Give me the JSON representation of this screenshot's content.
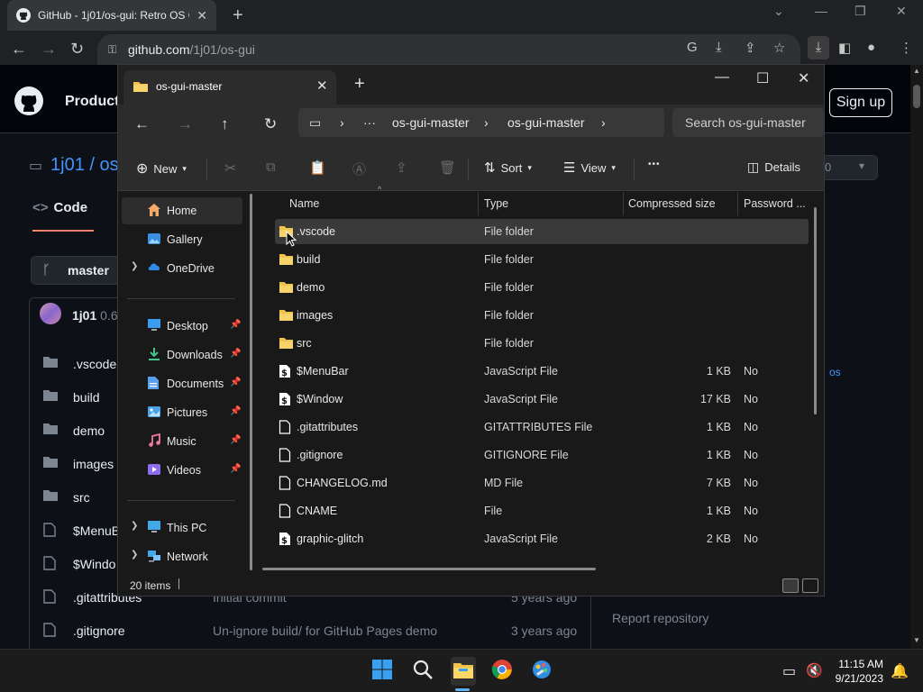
{
  "browser": {
    "tab_title": "GitHub - 1j01/os-gui: Retro OS G",
    "url_host": "github.com",
    "url_path": "/1j01/os-gui"
  },
  "github": {
    "product_label": "Product",
    "signup_label": "Sign up",
    "repo_owner": "1j01",
    "repo_name_partial": "os",
    "code_tab": "Code",
    "branch": "master",
    "commit_author": "1j01",
    "commit_version": "0.6.",
    "report": "Report repository",
    "files": [
      {
        "name": ".vscode",
        "type": "folder",
        "msg": "",
        "age": ""
      },
      {
        "name": "build",
        "type": "folder",
        "msg": "",
        "age": ""
      },
      {
        "name": "demo",
        "type": "folder",
        "msg": "",
        "age": ""
      },
      {
        "name": "images",
        "type": "folder",
        "msg": "",
        "age": ""
      },
      {
        "name": "src",
        "type": "folder",
        "msg": "",
        "age": ""
      },
      {
        "name": "$MenuB",
        "type": "file",
        "msg": "",
        "age": ""
      },
      {
        "name": "$Windo",
        "type": "file",
        "msg": "",
        "age": ""
      },
      {
        "name": ".gitattributes",
        "type": "file",
        "msg": "Initial commit",
        "age": "5 years ago"
      },
      {
        "name": ".gitignore",
        "type": "file",
        "msg": "Un-ignore build/ for GitHub Pages demo",
        "age": "3 years ago"
      }
    ],
    "side_tag": "os"
  },
  "explorer": {
    "tab_title": "os-gui-master",
    "address_parts": [
      "os-gui-master",
      "os-gui-master"
    ],
    "search_placeholder": "Search os-gui-master",
    "commands": {
      "new": "New",
      "sort": "Sort",
      "view": "View",
      "more": "•••",
      "details": "Details"
    },
    "nav_pane": [
      {
        "label": "Home",
        "icon": "home-icon",
        "selected": true
      },
      {
        "label": "Gallery",
        "icon": "gallery-icon"
      },
      {
        "label": "OneDrive",
        "icon": "onedrive-icon",
        "expandable": true
      },
      {
        "label": "Desktop",
        "icon": "desktop-icon",
        "pinned": true
      },
      {
        "label": "Downloads",
        "icon": "downloads-icon",
        "pinned": true
      },
      {
        "label": "Documents",
        "icon": "documents-icon",
        "pinned": true
      },
      {
        "label": "Pictures",
        "icon": "pictures-icon",
        "pinned": true
      },
      {
        "label": "Music",
        "icon": "music-icon",
        "pinned": true
      },
      {
        "label": "Videos",
        "icon": "videos-icon",
        "pinned": true
      },
      {
        "label": "This PC",
        "icon": "this-pc-icon",
        "expandable": true
      },
      {
        "label": "Network",
        "icon": "network-icon",
        "expandable": true
      }
    ],
    "columns": [
      "Name",
      "Type",
      "Compressed size",
      "Password ..."
    ],
    "rows": [
      {
        "name": ".vscode",
        "type": "File folder",
        "size": "",
        "pw": "",
        "kind": "folder",
        "selected": true
      },
      {
        "name": "build",
        "type": "File folder",
        "size": "",
        "pw": "",
        "kind": "folder"
      },
      {
        "name": "demo",
        "type": "File folder",
        "size": "",
        "pw": "",
        "kind": "folder"
      },
      {
        "name": "images",
        "type": "File folder",
        "size": "",
        "pw": "",
        "kind": "folder"
      },
      {
        "name": "src",
        "type": "File folder",
        "size": "",
        "pw": "",
        "kind": "folder"
      },
      {
        "name": "$MenuBar",
        "type": "JavaScript File",
        "size": "1 KB",
        "pw": "No",
        "kind": "js"
      },
      {
        "name": "$Window",
        "type": "JavaScript File",
        "size": "17 KB",
        "pw": "No",
        "kind": "js"
      },
      {
        "name": ".gitattributes",
        "type": "GITATTRIBUTES File",
        "size": "1 KB",
        "pw": "No",
        "kind": "file"
      },
      {
        "name": ".gitignore",
        "type": "GITIGNORE File",
        "size": "1 KB",
        "pw": "No",
        "kind": "file"
      },
      {
        "name": "CHANGELOG.md",
        "type": "MD File",
        "size": "7 KB",
        "pw": "No",
        "kind": "file"
      },
      {
        "name": "CNAME",
        "type": "File",
        "size": "1 KB",
        "pw": "No",
        "kind": "file"
      },
      {
        "name": "graphic-glitch",
        "type": "JavaScript File",
        "size": "2 KB",
        "pw": "No",
        "kind": "js"
      }
    ],
    "status": "20 items"
  },
  "taskbar": {
    "time": "11:15 AM",
    "date": "9/21/2023"
  },
  "colors": {
    "folder": "#f0c34a",
    "accent": "#4493f8"
  }
}
